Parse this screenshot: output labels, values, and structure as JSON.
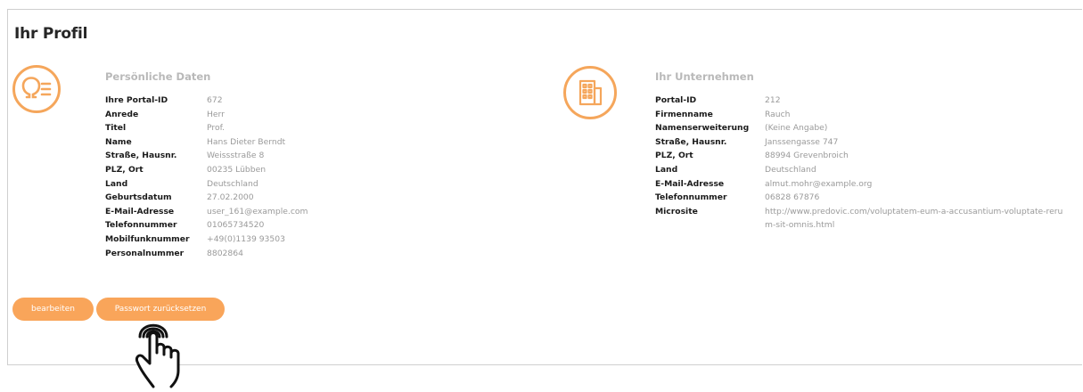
{
  "page": {
    "title": "Ihr Profil"
  },
  "personal": {
    "icon": "user-profile-icon",
    "title": "Persönliche Daten",
    "fields": [
      {
        "label": "Ihre Portal-ID",
        "value": "672"
      },
      {
        "label": "Anrede",
        "value": "Herr"
      },
      {
        "label": "Titel",
        "value": "Prof."
      },
      {
        "label": "Name",
        "value": "Hans Dieter Berndt"
      },
      {
        "label": "Straße, Hausnr.",
        "value": "Weissstraße 8"
      },
      {
        "label": "PLZ, Ort",
        "value": "00235 Lübben"
      },
      {
        "label": "Land",
        "value": "Deutschland"
      },
      {
        "label": "Geburtsdatum",
        "value": "27.02.2000"
      },
      {
        "label": "E-Mail-Adresse",
        "value": "user_161@example.com"
      },
      {
        "label": "Telefonnummer",
        "value": "01065734520"
      },
      {
        "label": "Mobilfunknummer",
        "value": "+49(0)1139 93503"
      },
      {
        "label": "Personalnummer",
        "value": "8802864"
      }
    ]
  },
  "company": {
    "icon": "building-icon",
    "title": "Ihr Unternehmen",
    "fields": [
      {
        "label": "Portal-ID",
        "value": "212"
      },
      {
        "label": "Firmenname",
        "value": "Rauch"
      },
      {
        "label": "Namenserweiterung",
        "value": "(Keine Angabe)"
      },
      {
        "label": "Straße, Hausnr.",
        "value": "Janssengasse 747"
      },
      {
        "label": "PLZ, Ort",
        "value": "88994 Grevenbroich"
      },
      {
        "label": "Land",
        "value": "Deutschland"
      },
      {
        "label": "E-Mail-Adresse",
        "value": "almut.mohr@example.org"
      },
      {
        "label": "Telefonnummer",
        "value": "06828 67876"
      },
      {
        "label": "Microsite",
        "value": "http://www.predovic.com/voluptatem-eum-a-accusantium-voluptate-rerum-sit-omnis.html"
      }
    ]
  },
  "actions": {
    "edit_label": "bearbeiten",
    "reset_password_label": "Passwort zurücksetzen"
  },
  "overlay": {
    "cursor_icon": "hand-pointer-icon"
  },
  "colors": {
    "accent": "#f9a55a",
    "icon_stroke": "#f5a65b",
    "value_text": "#9a9a9a",
    "section_title": "#b9b9b9"
  }
}
